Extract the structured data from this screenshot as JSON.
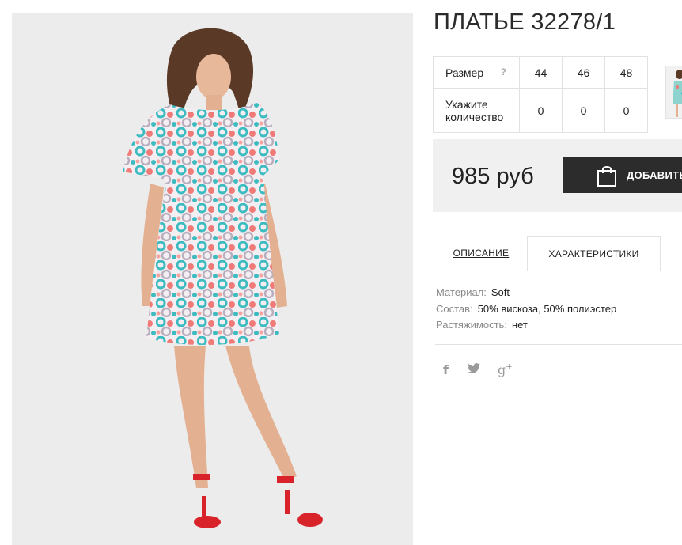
{
  "product": {
    "title": "ПЛАТЬЕ 32278/1"
  },
  "size_table": {
    "size_label": "Размер",
    "help": "?",
    "sizes": [
      "44",
      "46",
      "48"
    ],
    "qty_label": "Укажите количество",
    "quantities": [
      "0",
      "0",
      "0"
    ]
  },
  "price": {
    "value": "985 руб",
    "add_button": "ДОБАВИТЬ"
  },
  "tabs": {
    "description": "ОПИСАНИЕ",
    "characteristics": "ХАРАКТЕРИСТИКИ"
  },
  "specs": [
    {
      "key": "Материал:",
      "value": "Soft"
    },
    {
      "key": "Состав:",
      "value": "50% вискоза, 50% полиэстер"
    },
    {
      "key": "Растяжимость:",
      "value": "нет"
    }
  ],
  "social": {
    "facebook": "f",
    "twitter": "𝕥",
    "googleplus": "g"
  },
  "colors": {
    "button_bg": "#2c2c2c",
    "price_bg": "#f0f0f0",
    "photo_bg": "#ececec",
    "dress_teal": "#3cbcc0",
    "dress_coral": "#f07a78",
    "shoes_red": "#d8232a"
  }
}
